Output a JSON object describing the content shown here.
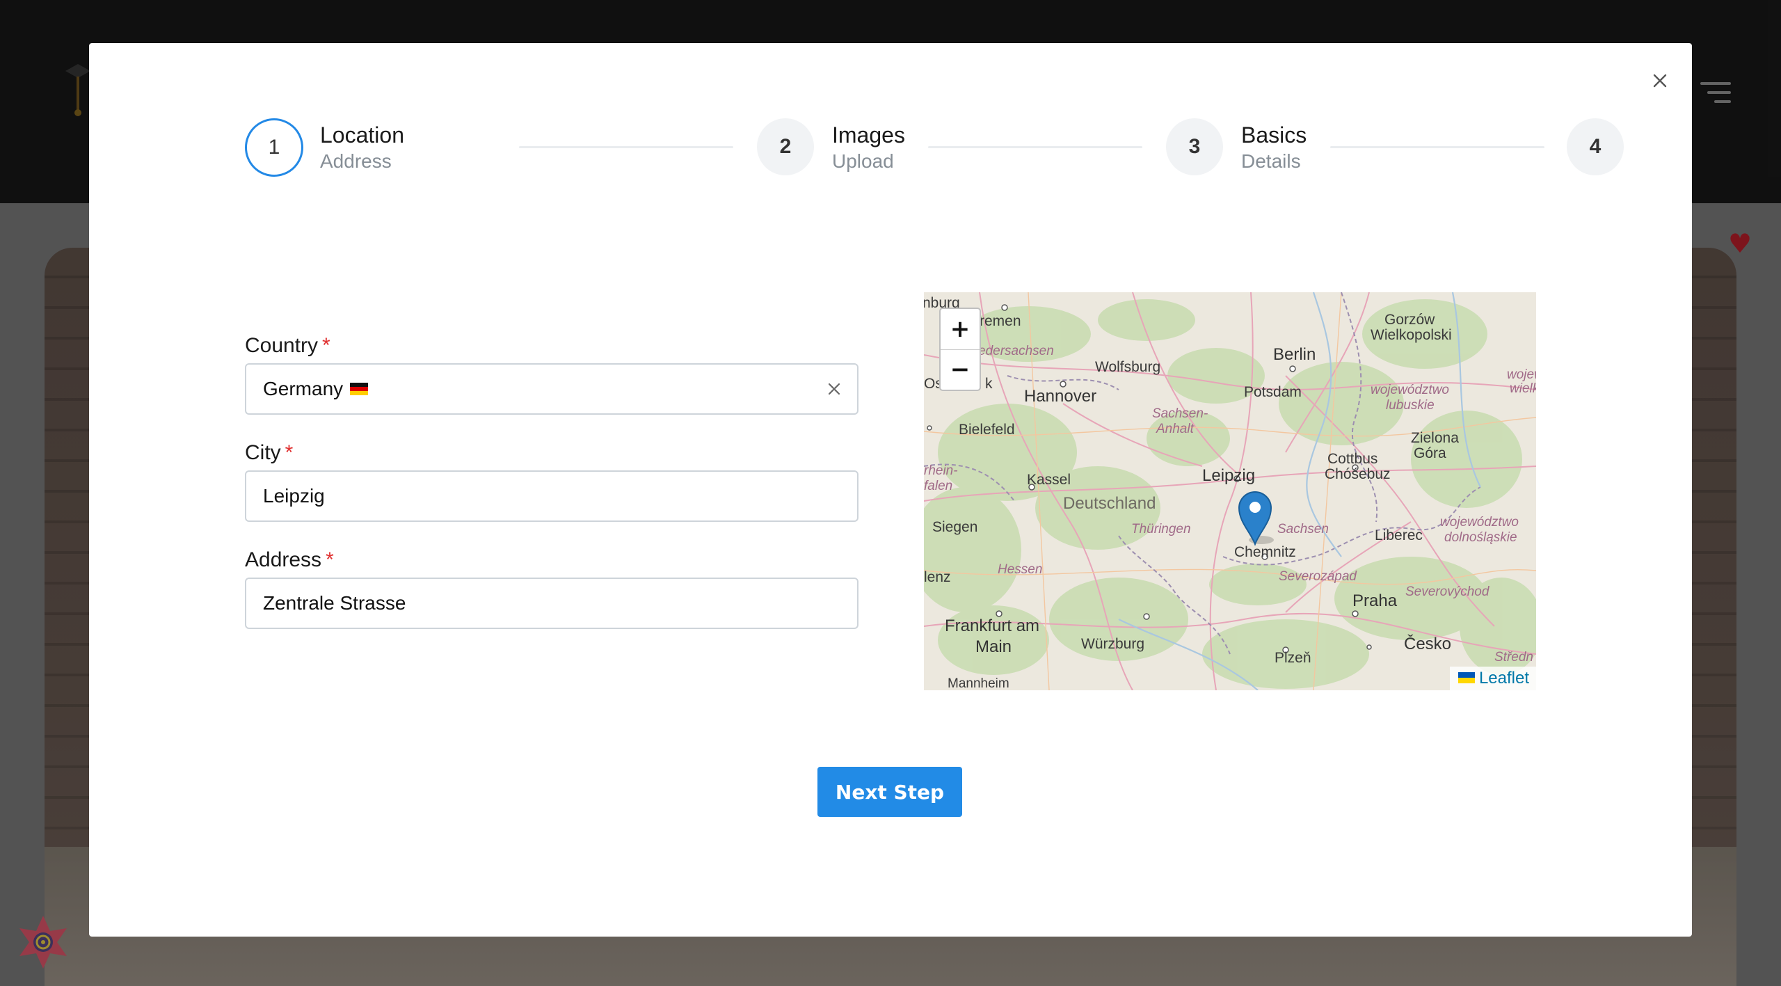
{
  "stepper": {
    "steps": [
      {
        "number": "1",
        "title": "Location",
        "subtitle": "Address",
        "active": true
      },
      {
        "number": "2",
        "title": "Images",
        "subtitle": "Upload",
        "active": false
      },
      {
        "number": "3",
        "title": "Basics",
        "subtitle": "Details",
        "active": false
      },
      {
        "number": "4",
        "title": "",
        "subtitle": "",
        "active": false
      }
    ]
  },
  "form": {
    "country": {
      "label": "Country",
      "required_mark": "*",
      "value": "Germany",
      "flag_icon": "germany-flag-icon"
    },
    "city": {
      "label": "City",
      "required_mark": "*",
      "value": "Leipzig"
    },
    "address": {
      "label": "Address",
      "required_mark": "*",
      "value": "Zentrale Strasse"
    }
  },
  "map": {
    "zoom_in": "+",
    "zoom_out": "−",
    "attribution": "Leaflet",
    "labels": {
      "bremen": "remen",
      "hamburg": "nburg",
      "niedersachsen": "edersachsen",
      "wolfsburg": "Wolfsburg",
      "hannover": "Hannover",
      "berlin": "Berlin",
      "potsdam": "Potsdam",
      "gorzow1": "Gorzów",
      "gorzow2": "Wielkopolski",
      "woj1": "wojew",
      "woj2": "wielk",
      "lubuskie1": "województwo",
      "lubuskie2": "lubuskie",
      "bielefeld": "Bielefeld",
      "sachsenanhalt1": "Sachsen-",
      "sachsenanhalt2": "Anhalt",
      "zielona1": "Zielona",
      "zielona2": "Góra",
      "osn": "Os",
      "k": "k",
      "nrw1": "rhein-",
      "nrw2": "falen",
      "kassel": "Kassel",
      "leipzig": "Leipzig",
      "cottbus1": "Cottbus",
      "cottbus2": "Chóśebuz",
      "deutschland": "Deutschland",
      "thueringen": "Thüringen",
      "sachsen": "Sachsen",
      "liberec": "Liberec",
      "dolnoslaskie1": "województwo",
      "dolnoslaskie2": "dolnośląskie",
      "siegen": "Siegen",
      "chemnitz": "Chemnitz",
      "hessen": "Hessen",
      "severozapad": "Severozápad",
      "koblenz": "lenz",
      "praha": "Praha",
      "severovychod": "Severovýchod",
      "frankfurt1": "Frankfurt am",
      "frankfurt2": "Main",
      "wuerzburg": "Würzburg",
      "plzen": "Plzeň",
      "cesko": "Česko",
      "stredni": "Středn",
      "mannheim": "Mannheim"
    }
  },
  "actions": {
    "next_label": "Next Step"
  },
  "colors": {
    "accent": "#228be6",
    "active_step_border": "#2389e6",
    "required": "#e03131"
  }
}
